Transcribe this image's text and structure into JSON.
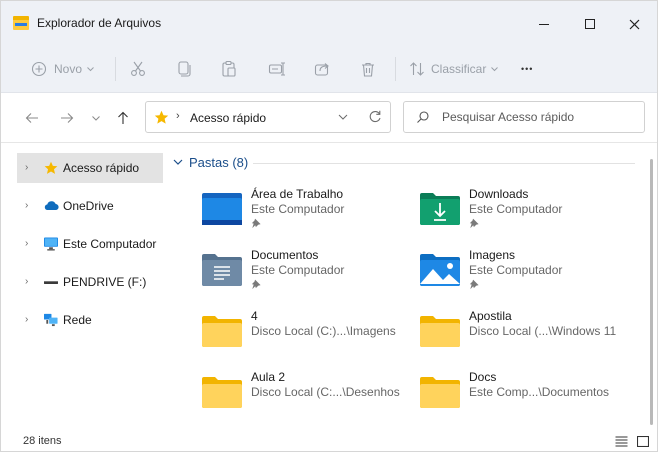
{
  "window": {
    "title": "Explorador de Arquivos"
  },
  "toolbar": {
    "new_label": "Novo",
    "sort_label": "Classificar",
    "more_label": "•••"
  },
  "address": {
    "path": "Acesso rápido",
    "search_placeholder": "Pesquisar Acesso rápido"
  },
  "sidebar": {
    "items": [
      {
        "label": "Acesso rápido",
        "icon": "star-icon",
        "active": true
      },
      {
        "label": "OneDrive",
        "icon": "cloud-icon"
      },
      {
        "label": "Este Computador",
        "icon": "monitor-icon"
      },
      {
        "label": "PENDRIVE (F:)",
        "icon": "usb-drive-icon"
      },
      {
        "label": "Rede",
        "icon": "network-icon"
      }
    ]
  },
  "main": {
    "group_title": "Pastas (8)",
    "folders": [
      {
        "name": "Área de Trabalho",
        "location": "Este Computador",
        "icon": "desktop-folder-icon",
        "pinned": true
      },
      {
        "name": "Downloads",
        "location": "Este Computador",
        "icon": "downloads-folder-icon",
        "pinned": true
      },
      {
        "name": "Documentos",
        "location": "Este Computador",
        "icon": "documents-folder-icon",
        "pinned": true
      },
      {
        "name": "Imagens",
        "location": "Este Computador",
        "icon": "pictures-folder-icon",
        "pinned": true
      },
      {
        "name": "4",
        "location": "Disco Local (C:)...\\Imagens",
        "icon": "folder-icon"
      },
      {
        "name": "Apostila",
        "location": "Disco Local (...\\Windows 11",
        "icon": "folder-icon"
      },
      {
        "name": "Aula 2",
        "location": "Disco Local (C:...\\Desenhos",
        "icon": "folder-icon"
      },
      {
        "name": "Docs",
        "location": "Este Comp...\\Documentos",
        "icon": "folder-icon"
      }
    ]
  },
  "status": {
    "item_count": "28 itens"
  },
  "colors": {
    "accent": "#1b4e8a",
    "folder_yellow": "#ffcb3d",
    "desktop_blue": "#1e88e5",
    "downloads_green": "#0f9d6e"
  }
}
